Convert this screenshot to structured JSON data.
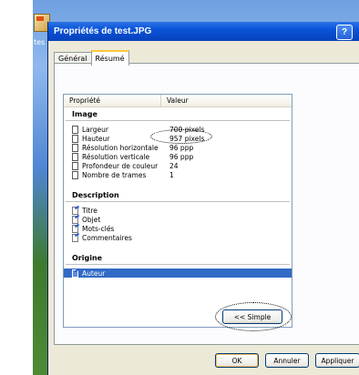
{
  "desktop": {
    "icon_label": "tes"
  },
  "dialog": {
    "title": "Propriétés de test.JPG",
    "help_label": "?"
  },
  "tabs": [
    {
      "label": "Général",
      "active": false
    },
    {
      "label": "Résumé",
      "active": true
    }
  ],
  "list": {
    "headers": {
      "property": "Propriété",
      "value": "Valeur"
    },
    "sections": [
      {
        "title": "Image",
        "rows": [
          {
            "name": "Largeur",
            "value": "700 pixels"
          },
          {
            "name": "Hauteur",
            "value": "957 pixels"
          },
          {
            "name": "Résolution horizontale",
            "value": "96 ppp"
          },
          {
            "name": "Résolution verticale",
            "value": "96 ppp"
          },
          {
            "name": "Profondeur de couleur",
            "value": "24"
          },
          {
            "name": "Nombre de trames",
            "value": "1"
          }
        ]
      },
      {
        "title": "Description",
        "rows": [
          {
            "name": "Titre",
            "value": ""
          },
          {
            "name": "Objet",
            "value": ""
          },
          {
            "name": "Mots-clés",
            "value": ""
          },
          {
            "name": "Commentaires",
            "value": ""
          }
        ]
      },
      {
        "title": "Origine",
        "rows": [
          {
            "name": "Auteur",
            "value": ""
          }
        ]
      }
    ]
  },
  "buttons": {
    "simple": "<< Simple",
    "ok": "OK",
    "cancel": "Annuler",
    "apply": "Appliquer"
  },
  "colors": {
    "titlebar": "#0a53d8",
    "selection": "#316ac5",
    "dialog_bg": "#ece9d8"
  }
}
